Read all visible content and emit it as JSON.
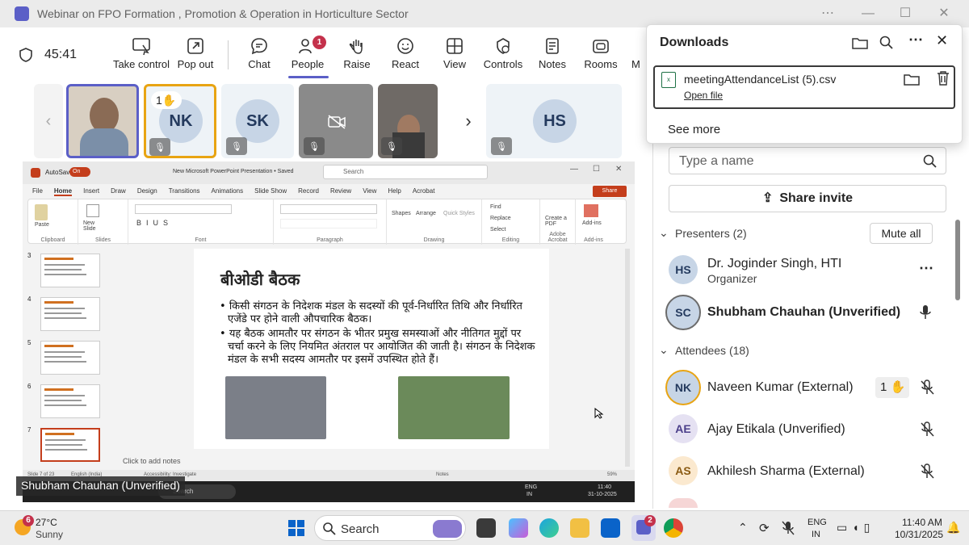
{
  "window": {
    "title": "Webinar on FPO Formation , Promotion & Operation in Horticulture Sector"
  },
  "meeting": {
    "timer": "45:41",
    "toolbar": [
      {
        "label": "Take control",
        "icon": "take-control-icon"
      },
      {
        "label": "Pop out",
        "icon": "pop-out-icon"
      },
      {
        "label": "Chat",
        "icon": "chat-icon"
      },
      {
        "label": "People",
        "icon": "people-icon",
        "badge": "1"
      },
      {
        "label": "Raise",
        "icon": "raise-hand-icon"
      },
      {
        "label": "React",
        "icon": "react-icon"
      },
      {
        "label": "View",
        "icon": "view-icon"
      },
      {
        "label": "Controls",
        "icon": "controls-icon"
      },
      {
        "label": "Notes",
        "icon": "notes-icon"
      },
      {
        "label": "Rooms",
        "icon": "rooms-icon"
      },
      {
        "label": "M",
        "icon": "more-icon"
      }
    ],
    "participants_strip": [
      {
        "initials": "",
        "type": "video"
      },
      {
        "initials": "NK",
        "hand": "1",
        "type": "avatar"
      },
      {
        "initials": "SK",
        "type": "avatar"
      },
      {
        "initials": "",
        "type": "camera-off"
      },
      {
        "initials": "",
        "type": "video"
      },
      {
        "initials": "HS",
        "type": "avatar"
      }
    ],
    "caption": "Shubham Chauhan (Unverified)"
  },
  "ppt": {
    "autosave": "AutoSave",
    "autosave_state": "On",
    "doc_title": "New Microsoft PowerPoint Presentation • Saved",
    "search": "Search",
    "tabs": [
      "File",
      "Home",
      "Insert",
      "Draw",
      "Design",
      "Transitions",
      "Animations",
      "Slide Show",
      "Record",
      "Review",
      "View",
      "Help",
      "Acrobat"
    ],
    "share": "Share",
    "groups": [
      "Clipboard",
      "Slides",
      "Font",
      "Paragraph",
      "Drawing",
      "Editing",
      "Adobe Acrobat",
      "Add-ins"
    ],
    "buttons": {
      "paste": "Paste",
      "new_slide": "New Slide",
      "shapes": "Shapes",
      "arrange": "Arrange",
      "quick_styles": "Quick Styles",
      "find": "Find",
      "replace": "Replace",
      "select": "Select",
      "create_pdf": "Create a PDF",
      "addins": "Add-ins"
    },
    "thumb_numbers": [
      "3",
      "4",
      "5",
      "6",
      "7"
    ],
    "slide": {
      "title": "बीओडी बैठक",
      "bullets": [
        "किसी संगठन के निदेशक मंडल के सदस्यों की पूर्व-निर्धारित तिथि और निर्धारित एजेंडे पर होने वाली औपचारिक बैठक।",
        "यह बैठक आमतौर पर संगठन के भीतर प्रमुख समस्याओं और नीतिगत मुद्दों पर चर्चा करने के लिए नियमित अंतराल पर आयोजित की जाती है। संगठन के निदेशक मंडल के सभी सदस्य आमतौर पर इसमें उपस्थित होते हैं।"
      ]
    },
    "notes_placeholder": "Click to add notes",
    "status": {
      "slide": "Slide 7 of 23",
      "lang": "English (India)",
      "access": "Accessibility: Investigate",
      "notes": "Notes",
      "zoom": "59%"
    },
    "mini_taskbar": {
      "search": "Search",
      "lang1": "ENG",
      "lang2": "IN",
      "time": "11:40",
      "date": "31-10-2025"
    }
  },
  "downloads": {
    "title": "Downloads",
    "file": "meetingAttendanceList (5).csv",
    "open": "Open file",
    "see_more": "See more"
  },
  "people": {
    "search_placeholder": "Type a name",
    "share_invite": "Share invite",
    "presenters_label": "Presenters (2)",
    "mute_all": "Mute all",
    "presenters": [
      {
        "initials": "HS",
        "name": "Dr. Joginder Singh, HTI",
        "role": "Organizer"
      },
      {
        "initials": "SC",
        "name": "Shubham Chauhan (Unverified)",
        "role": ""
      }
    ],
    "attendees_label": "Attendees (18)",
    "attendees": [
      {
        "initials": "NK",
        "name": "Naveen Kumar (External)",
        "hand": "1"
      },
      {
        "initials": "AE",
        "name": "Ajay Etikala (Unverified)",
        "hand": ""
      },
      {
        "initials": "AS",
        "name": "Akhilesh Sharma (External)",
        "hand": ""
      }
    ]
  },
  "taskbar": {
    "weather_badge": "6",
    "temp": "27°C",
    "weather": "Sunny",
    "search": "Search",
    "teams_badge": "2",
    "lang1": "ENG",
    "lang2": "IN",
    "time": "11:40 AM",
    "date": "10/31/2025"
  },
  "colors": {
    "accent": "#5b5fc7",
    "badge": "#c4314b",
    "ppt_red": "#c43e1c"
  }
}
